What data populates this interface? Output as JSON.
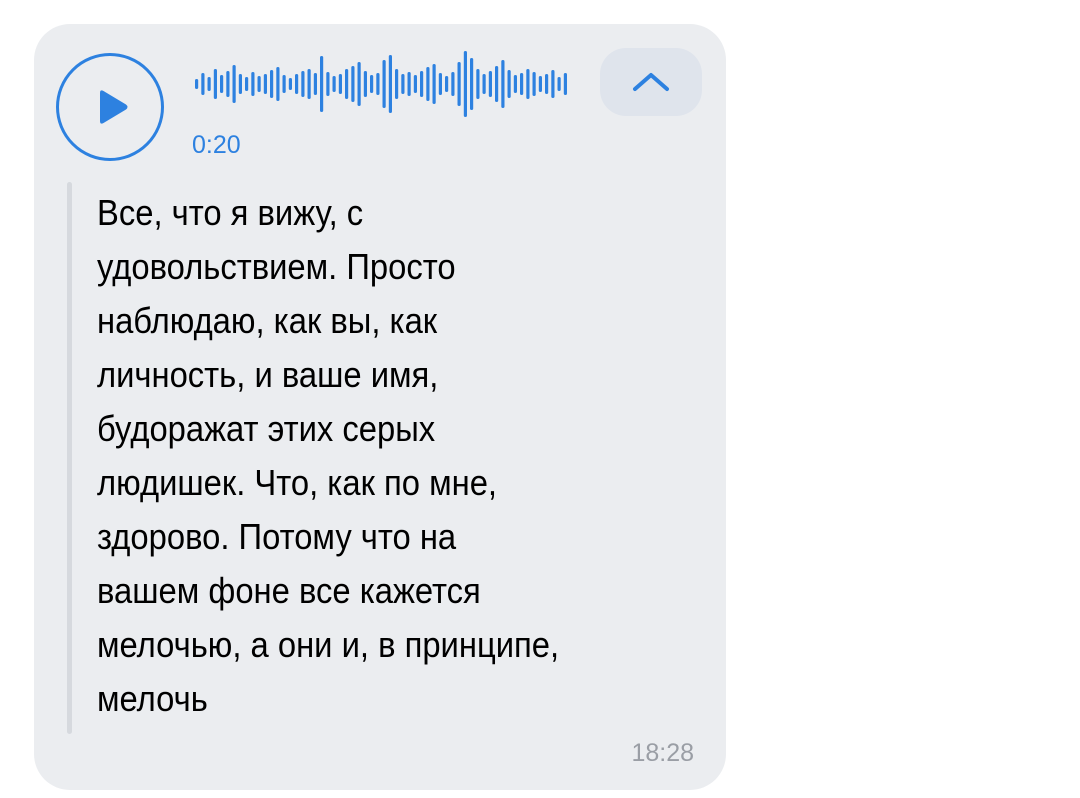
{
  "message": {
    "duration": "0:20",
    "transcript": "Все, что я вижу, с\nудовольствием. Просто\nнаблюдаю, как вы, как\nличность, и ваше имя,\nбудоражат этих серых\nлюдишек. Что, как по мне,\nздорово. Потому что на\nвашем фоне все кажется\nмелочью, а они и, в принципе,\nмелочь",
    "time": "18:28",
    "icons": {
      "play": "play-icon",
      "collapse": "chevron-up-icon"
    },
    "colors": {
      "accent": "#2d81e0",
      "bubble": "#ebedf0",
      "collapse_bg": "#dfe4ec",
      "time": "#9a9ea5"
    }
  }
}
